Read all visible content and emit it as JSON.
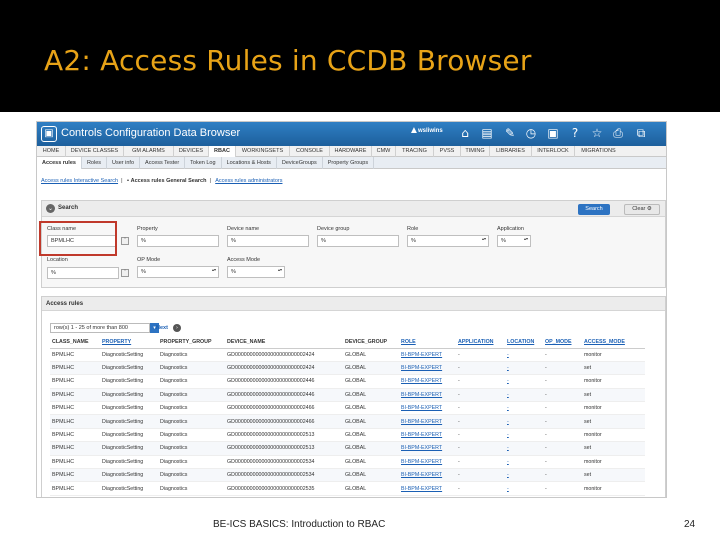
{
  "slide": {
    "title": "A2: Access Rules in CCDB Browser",
    "footer": "BE-ICS BASICS: Introduction to RBAC",
    "page": "24"
  },
  "app": {
    "title": "Controls Configuration Data Browser",
    "user": "wsliwins",
    "logo": "▣"
  },
  "toolbar_icons": [
    "home-icon",
    "document-icon",
    "edit-icon",
    "clock-icon",
    "camera-icon",
    "help-icon",
    "star-icon",
    "print-icon",
    "windows-icon"
  ],
  "menu": [
    "HOME",
    "DEVICE CLASSES",
    "GM ALARMS",
    "DEVICES",
    "RBAC",
    "WORKINGSETS",
    "CONSOLE",
    "HARDWARE",
    "CMW",
    "TRACING",
    "PVSS",
    "TIMING",
    "LIBRARIES",
    "INTERLOCK",
    "MIGRATIONS"
  ],
  "menu_active": "RBAC",
  "subtabs": [
    "Access rules",
    "Roles",
    "User info",
    "Access Tester",
    "Token Log",
    "Locations & Hosts",
    "DeviceGroups",
    "Property Groups"
  ],
  "links": {
    "interactive": "Access rules Interactive Search",
    "general": "Access rules General Search",
    "admins": "Access rules administrators"
  },
  "search": {
    "title": "Search",
    "search_button": "Search",
    "clear_button": "Clear",
    "class_label": "Class name",
    "class_value": "BPMLHC",
    "property_label": "Property",
    "property_value": "%",
    "device_label": "Device name",
    "device_value": "%",
    "group_label": "Device group",
    "group_value": "%",
    "role_label": "Role",
    "role_value": "%",
    "app_label": "Application",
    "app_value": "%",
    "location_label": "Location",
    "location_value": "%",
    "opmode_label": "OP Mode",
    "opmode_value": "%",
    "access_label": "Access Mode",
    "access_value": "%"
  },
  "rules": {
    "title": "Access rules",
    "pager": "row(s) 1 - 25 of more than 800",
    "next": "Next",
    "columns": [
      "CLASS_NAME",
      "PROPERTY",
      "PROPERTY_GROUP",
      "DEVICE_NAME",
      "DEVICE_GROUP",
      "ROLE",
      "APPLICATION",
      "LOCATION",
      "OP_MODE",
      "ACCESS_MODE"
    ],
    "rows": [
      [
        "BPMLHC",
        "DiagnosticSetting",
        "Diagnostics",
        "GD000000000000000000000002424",
        "GLOBAL",
        "BI-BPM-EXPERT",
        "-",
        "-",
        "-",
        "monitor"
      ],
      [
        "BPMLHC",
        "DiagnosticSetting",
        "Diagnostics",
        "GD000000000000000000000002424",
        "GLOBAL",
        "BI-BPM-EXPERT",
        "-",
        "-",
        "-",
        "set"
      ],
      [
        "BPMLHC",
        "DiagnosticSetting",
        "Diagnostics",
        "GD000000000000000000000002446",
        "GLOBAL",
        "BI-BPM-EXPERT",
        "-",
        "-",
        "-",
        "monitor"
      ],
      [
        "BPMLHC",
        "DiagnosticSetting",
        "Diagnostics",
        "GD000000000000000000000002446",
        "GLOBAL",
        "BI-BPM-EXPERT",
        "-",
        "-",
        "-",
        "set"
      ],
      [
        "BPMLHC",
        "DiagnosticSetting",
        "Diagnostics",
        "GD000000000000000000000002466",
        "GLOBAL",
        "BI-BPM-EXPERT",
        "-",
        "-",
        "-",
        "monitor"
      ],
      [
        "BPMLHC",
        "DiagnosticSetting",
        "Diagnostics",
        "GD000000000000000000000002466",
        "GLOBAL",
        "BI-BPM-EXPERT",
        "-",
        "-",
        "-",
        "set"
      ],
      [
        "BPMLHC",
        "DiagnosticSetting",
        "Diagnostics",
        "GD000000000000000000000002513",
        "GLOBAL",
        "BI-BPM-EXPERT",
        "-",
        "-",
        "-",
        "monitor"
      ],
      [
        "BPMLHC",
        "DiagnosticSetting",
        "Diagnostics",
        "GD000000000000000000000002513",
        "GLOBAL",
        "BI-BPM-EXPERT",
        "-",
        "-",
        "-",
        "set"
      ],
      [
        "BPMLHC",
        "DiagnosticSetting",
        "Diagnostics",
        "GD000000000000000000000002534",
        "GLOBAL",
        "BI-BPM-EXPERT",
        "-",
        "-",
        "-",
        "monitor"
      ],
      [
        "BPMLHC",
        "DiagnosticSetting",
        "Diagnostics",
        "GD000000000000000000000002534",
        "GLOBAL",
        "BI-BPM-EXPERT",
        "-",
        "-",
        "-",
        "set"
      ],
      [
        "BPMLHC",
        "DiagnosticSetting",
        "Diagnostics",
        "GD000000000000000000000002535",
        "GLOBAL",
        "BI-BPM-EXPERT",
        "-",
        "-",
        "-",
        "monitor"
      ]
    ]
  }
}
